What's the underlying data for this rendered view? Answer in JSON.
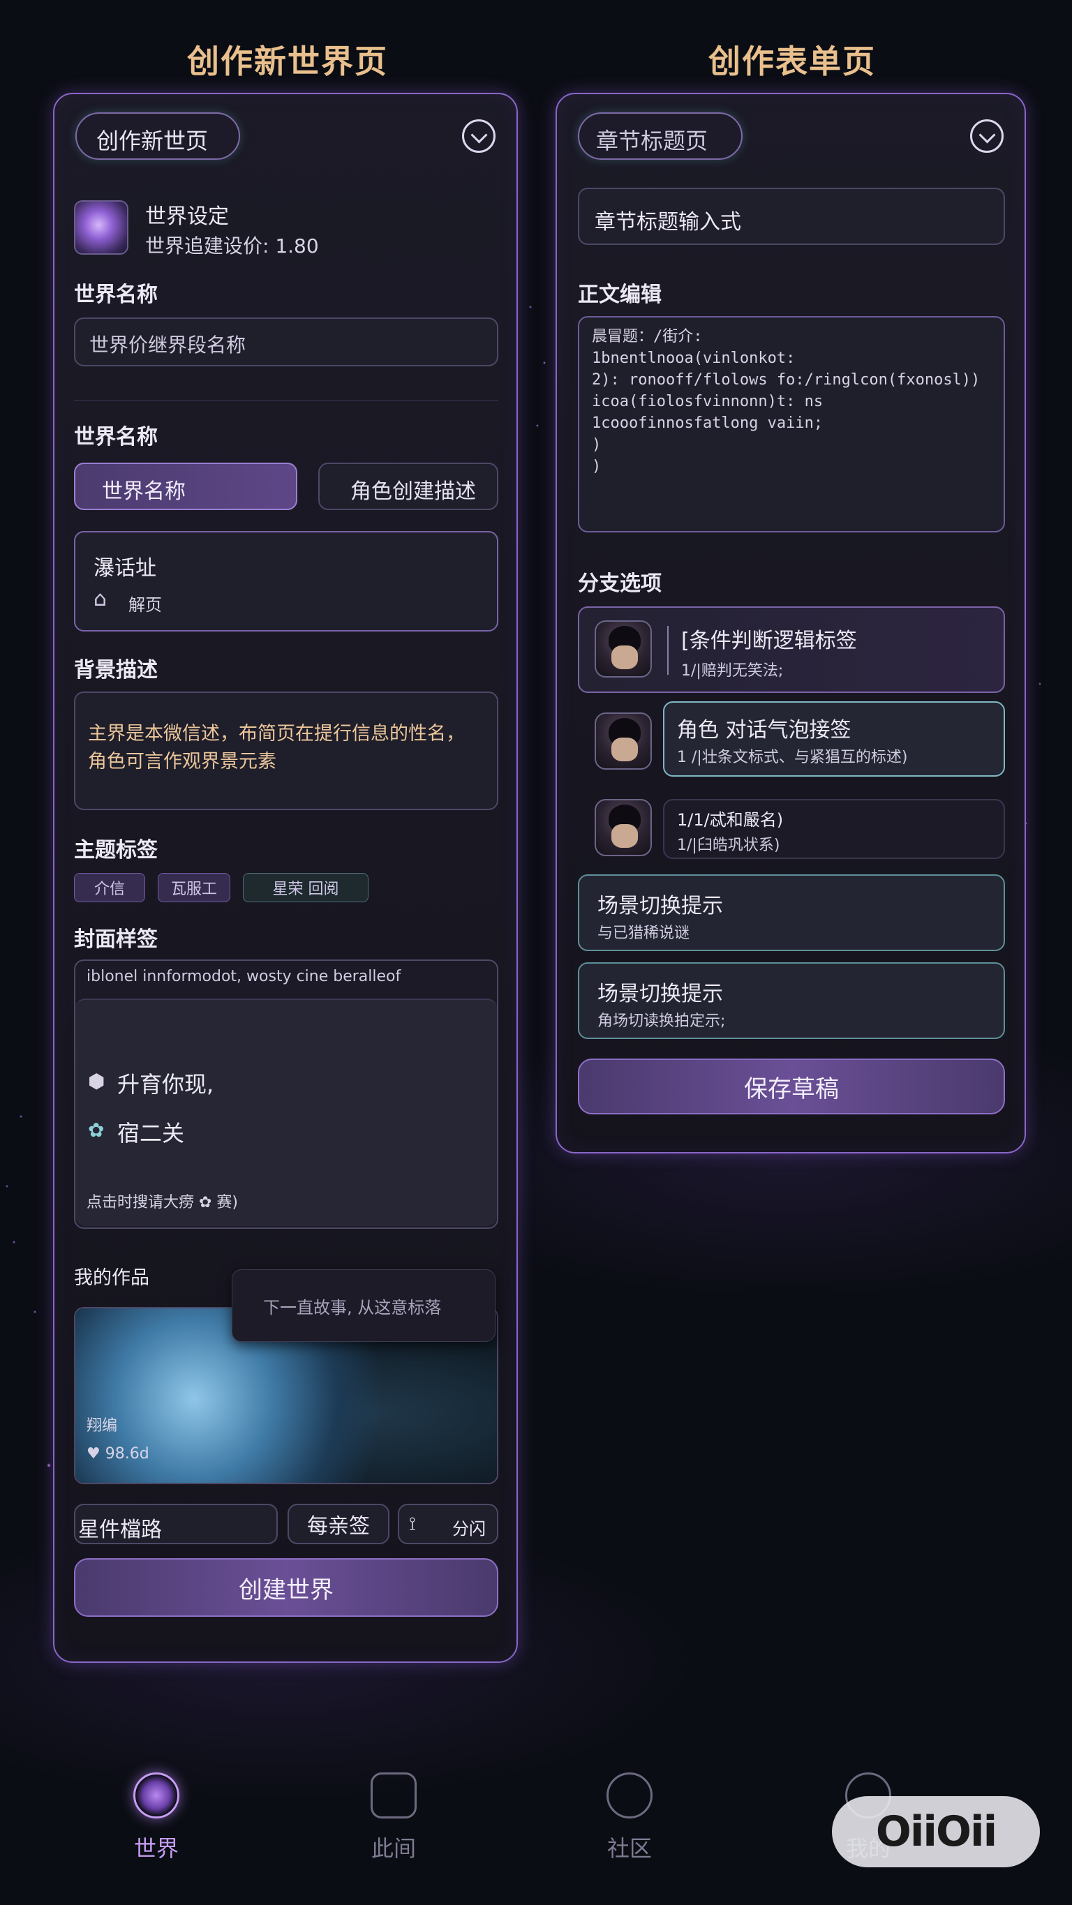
{
  "headings": {
    "left": "创作新世界页",
    "right": "创作表单页"
  },
  "left": {
    "header_pill": "创作新世页",
    "world_setting_title": "世界设定",
    "world_setting_sub": "世界追建设价: 1.80",
    "world_name_label": "世界名称",
    "world_name_placeholder": "世界价继界段名称",
    "world_name_label2": "世界名称",
    "seg_primary": "世界名称",
    "seg_secondary": "角色创建描述",
    "card_title": "瀑话址",
    "card_sub": "解页",
    "bg_label": "背景描述",
    "bg_text_line1": "主界是本微信述，布简页在提行信息的性名，",
    "bg_text_line2": "角色可言作观界景元素",
    "theme_label": "主题标签",
    "tags": [
      "介信",
      "瓦服工",
      "星荣 回阅"
    ],
    "cover_label": "封面样签",
    "cover_top_text": "iblonel innformodot, wosty cine beralleof",
    "cover_item1": "升育你现,",
    "cover_item2": "宿二关",
    "cover_bottom": "点击时搜请大痨 ✿ 赛)",
    "works_label": "我的作品",
    "tooltip": "下一直故事, 从这意标落",
    "work_caption": "翔编",
    "work_likes": "♥ 98.6d",
    "bottom_field": "星件檔路",
    "bottom_btn1": "每亲签",
    "bottom_btn2": "分闪",
    "create_btn": "创建世界"
  },
  "right": {
    "header_pill": "章节标题页",
    "chapter_input": "章节标题输入式",
    "body_label": "正文编辑",
    "code_lines": [
      "晨冒题：/街介:",
      "1bnentlnooa(vinlonkot:",
      "2): ronooff/flolows fo:/ringlcon(fxonosl))",
      "icoa(fiolosfvinnonn)t: ns",
      "1cooofinnosfatlong vaiin;",
      ")",
      ")"
    ],
    "branch_label": "分支选项",
    "branches": [
      {
        "title": "[条件判断逻辑标签",
        "sub": "1/|赔判无笑法;"
      },
      {
        "title": "角色 对话气泡接签",
        "sub": "1 /|壮条文标式、与紧猖互的标述)"
      },
      {
        "title": "1/1/忒和嚴名)",
        "sub": "1/|臼皓巩状系)"
      }
    ],
    "scene1_title": "场景切换提示",
    "scene1_sub": "与已猎稀说谜",
    "scene2_title": "场景切换提示",
    "scene2_sub": "角场切读换拍定示;",
    "save_btn": "保存草稿"
  },
  "nav": {
    "items": [
      "世界",
      "此间",
      "社区",
      "我的"
    ]
  },
  "watermark": "OiiOii",
  "colors": {
    "accent": "#8a66c9",
    "heading": "#e9c08d",
    "background": "#0b0d14"
  }
}
